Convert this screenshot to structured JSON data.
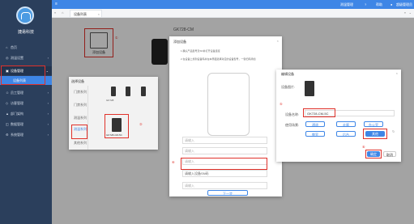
{
  "sidebar": {
    "brand": "捷易科技",
    "items": [
      {
        "label": "首页",
        "icon": "⌂"
      },
      {
        "label": "测温设置",
        "icon": "◎"
      },
      {
        "label": "设备管理",
        "icon": "▣"
      },
      {
        "label": "设备列表",
        "icon": ""
      },
      {
        "label": "员工管理",
        "icon": "☺"
      },
      {
        "label": "访客管理",
        "icon": "◇"
      },
      {
        "label": "部门架构",
        "icon": "▲"
      },
      {
        "label": "数据管理",
        "icon": "◫"
      },
      {
        "label": "系统管理",
        "icon": "⚙"
      }
    ]
  },
  "topbar": {
    "tab1": "测温管理",
    "tab2": "帮助",
    "user": "超级管理员"
  },
  "tabs": {
    "active": "设备列表"
  },
  "background": {
    "model_label": "GK728-CM",
    "add_device_label": "添加设备",
    "num1": "①"
  },
  "device_types_dialog": {
    "title": "选择设备",
    "categories": [
      "门禁系列",
      "门禁系列",
      "测温系列",
      "测温系列",
      "其他系列"
    ],
    "selected_category_index": 3,
    "devices": [
      "GK728",
      "",
      ""
    ],
    "selected_device": "GK728-CM-5C",
    "num2": "②"
  },
  "guide_dialog": {
    "title": "添加设备",
    "steps": [
      "1 确认产品型号及SN并打开设备连接",
      "2 在设备上找到设备码并在本界面选择对应的设备型号，一键扫码添加"
    ],
    "fields": [
      "请输入",
      "请输入",
      "请输入",
      "请输入"
    ],
    "sn_placeholder": "请输入设备SN码",
    "next_button": "下一步",
    "num4": "④"
  },
  "edit_dialog": {
    "title": "编辑设备",
    "label_image": "设备图片:",
    "label_name": "设备名称:",
    "label_scene": "使用场景:",
    "device_name_value": "GK728-CM-5C",
    "scenes": [
      "通道",
      "走廊",
      "办公室",
      "教室",
      "后台",
      "其他"
    ],
    "selected_scene_index": 5,
    "confirm_button": "确定",
    "cancel_button": "取消",
    "num5": "⑤",
    "num6": "⑥"
  },
  "colors": {
    "accent": "#3e86e6",
    "sidebar": "#2b3f5c",
    "highlight": "#e0312a"
  }
}
